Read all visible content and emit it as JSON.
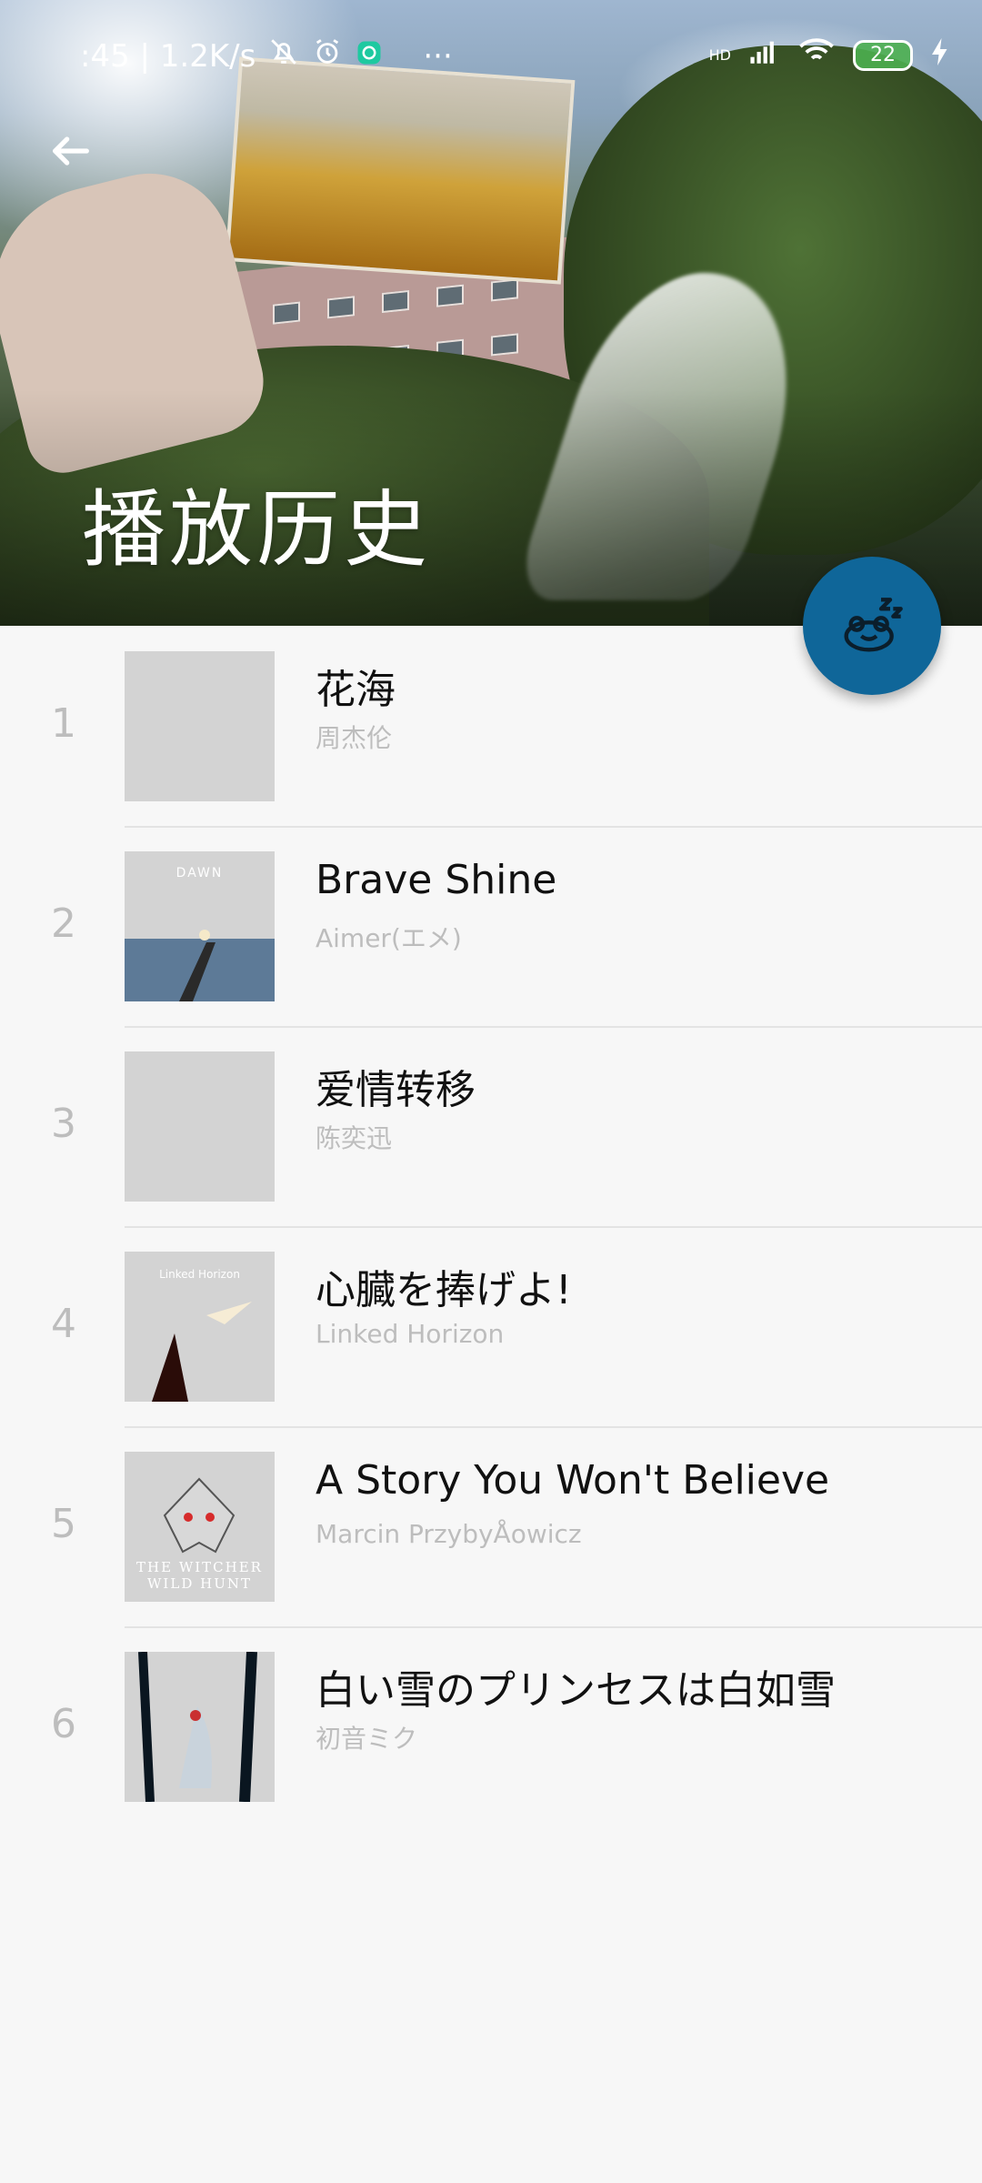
{
  "status_bar": {
    "time_speed": ":45 | 1.2K/s",
    "battery": "22",
    "network": "HD",
    "more": "···"
  },
  "header": {
    "title": "播放历史"
  },
  "icons": {
    "back": "arrow-left-icon",
    "fab": "sleep-timer-icon"
  },
  "colors": {
    "fab": "#0f6699",
    "number_text": "#bdbdbd",
    "artist_text": "#bdbdbd",
    "title_text": "#111111"
  },
  "songs": [
    {
      "index": "1",
      "title": "花海",
      "artist": "周杰伦",
      "cover": "placeholder"
    },
    {
      "index": "2",
      "title": "Brave Shine",
      "artist": "Aimer(エメ)",
      "cover": "DAWN"
    },
    {
      "index": "3",
      "title": "爱情转移",
      "artist": "陈奕迅",
      "cover": "placeholder"
    },
    {
      "index": "4",
      "title": "心臓を捧げよ!",
      "artist": "Linked Horizon",
      "cover": "Linked Horizon"
    },
    {
      "index": "5",
      "title": "A Story You Won't Believe",
      "artist": "Marcin PrzybyÅowicz",
      "cover": "THE WITCHER WILD HUNT"
    },
    {
      "index": "6",
      "title": "白い雪のプリンセスは白如雪",
      "artist": "初音ミク",
      "cover": "art"
    }
  ]
}
